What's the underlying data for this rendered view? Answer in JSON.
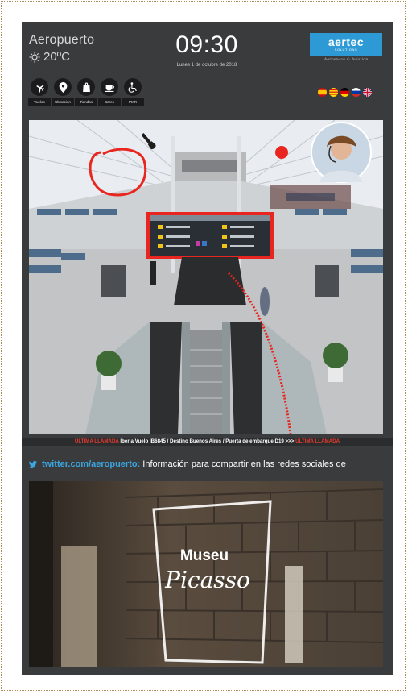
{
  "header": {
    "city": "Aeropuerto",
    "temperature": "20ºC",
    "weather_icon": "sun-icon",
    "time": "09:30",
    "date": "Lunes 1 de octubre de 2018"
  },
  "logo": {
    "main": "aertec",
    "sub": "SOLUTIONS",
    "tagline": "Aerospace & Aviation",
    "color": "#2d9ad6"
  },
  "nav": [
    {
      "label": "Vuelos",
      "icon": "airplane-icon"
    },
    {
      "label": "Ubicación",
      "icon": "location-pin-icon"
    },
    {
      "label": "Tiendas",
      "icon": "shopping-bag-icon"
    },
    {
      "label": "Bares",
      "icon": "coffee-cup-icon"
    },
    {
      "label": "PMR",
      "icon": "wheelchair-icon"
    }
  ],
  "languages": [
    "es",
    "ca",
    "de",
    "ru",
    "en"
  ],
  "ticker": {
    "prefix": "ÚLTIMA LLAMADA",
    "message": " Iberia Vuelo IB6845 / Destino Buenos Aires / Puerta de embarque D19  >>>  ",
    "suffix": "ÚLTIMA LLAMADA",
    "accent": "#e63b2e"
  },
  "twitter": {
    "handle": "twitter.com/aeropuerto:",
    "text": " Información para compartir en las redes sociales de",
    "color": "#3ba6e0"
  },
  "museum": {
    "line1": "Museu",
    "line2": "Picasso"
  }
}
